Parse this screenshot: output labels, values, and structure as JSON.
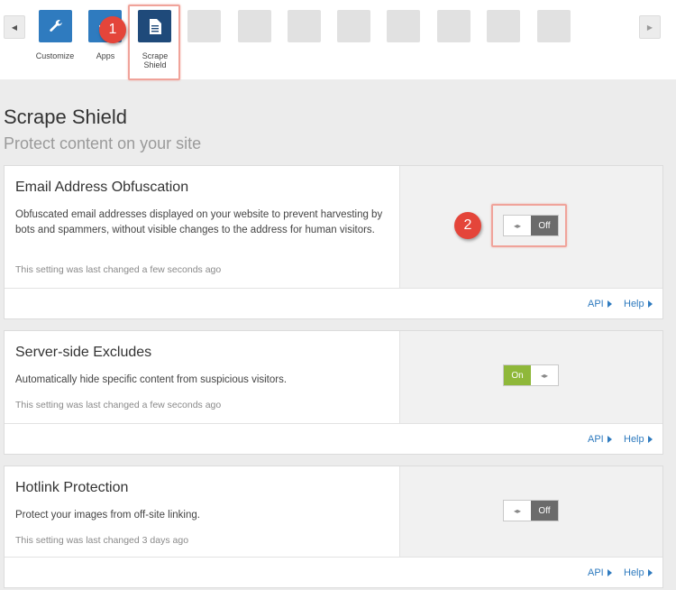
{
  "toolbar": {
    "tiles": [
      {
        "label": "Customize",
        "icon": "wrench-icon"
      },
      {
        "label": "Apps",
        "icon": "apps-icon"
      },
      {
        "label": "Scrape\nShield",
        "icon": "document-icon"
      }
    ],
    "callout_1": "1",
    "callout_2": "2"
  },
  "page": {
    "title": "Scrape Shield",
    "subtitle": "Protect content on your site"
  },
  "cards": [
    {
      "title": "Email Address Obfuscation",
      "description": "Obfuscated email addresses displayed on your website to prevent harvesting by bots and spammers, without visible changes to the address for human visitors.",
      "meta": "This setting was last changed a few seconds ago",
      "toggle_state": "Off",
      "api": "API",
      "help": "Help"
    },
    {
      "title": "Server-side Excludes",
      "description": "Automatically hide specific content from suspicious visitors.",
      "meta": "This setting was last changed a few seconds ago",
      "toggle_state": "On",
      "api": "API",
      "help": "Help"
    },
    {
      "title": "Hotlink Protection",
      "description": "Protect your images from off-site linking.",
      "meta": "This setting was last changed 3 days ago",
      "toggle_state": "Off",
      "api": "API",
      "help": "Help"
    }
  ],
  "colors": {
    "accent": "#2f7bbf",
    "on": "#8fb83a",
    "off": "#6b6b6b",
    "callout": "#e4453a"
  }
}
